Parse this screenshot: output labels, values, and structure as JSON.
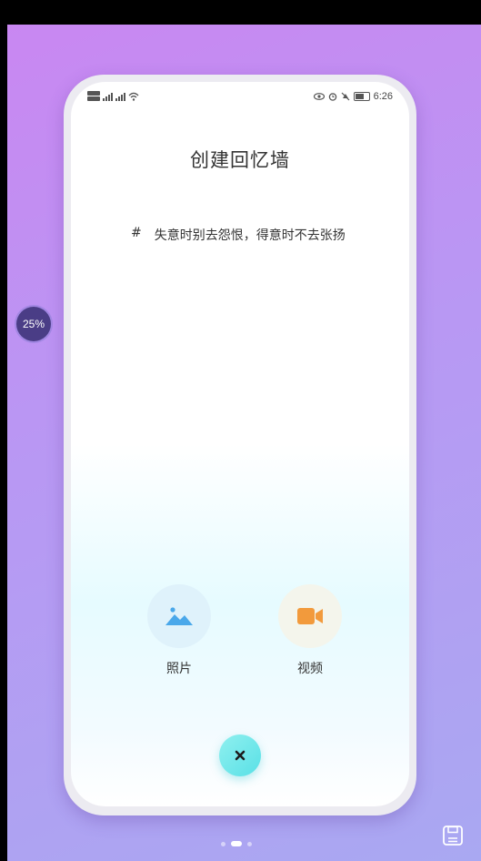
{
  "status_bar": {
    "time": "6:26",
    "left_icons": [
      "sim-card-icon",
      "signal-icon",
      "signal-icon",
      "wifi-icon"
    ],
    "right_icons": [
      "eye-icon",
      "alarm-icon",
      "mute-icon",
      "battery-icon"
    ]
  },
  "page": {
    "title": "创建回忆墙",
    "quote_hash": "#",
    "quote_text": "失意时别去怨恨，得意时不去张扬"
  },
  "options": [
    {
      "label": "照片",
      "icon": "image-icon",
      "color": "#4aa8ea"
    },
    {
      "label": "视频",
      "icon": "video-camera-icon",
      "color": "#f29a3c"
    }
  ],
  "close_button": {
    "icon": "close-icon"
  },
  "overlay": {
    "progress_text": "25%"
  },
  "pager": {
    "count": 3,
    "active_index": 1
  },
  "accent_colors": {
    "background_top": "#c987f2",
    "background_bottom": "#a9a8f2",
    "close_button": "#59e0e6"
  }
}
